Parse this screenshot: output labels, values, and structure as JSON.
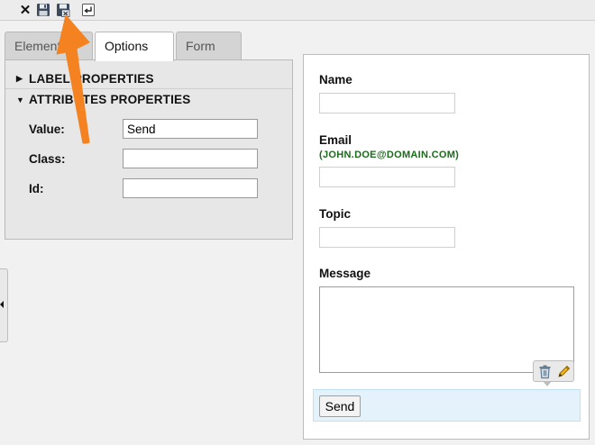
{
  "toolbar": {
    "close_glyph": "✕",
    "icons": [
      "close-icon",
      "save-icon",
      "save-and-close-icon",
      "return-icon"
    ]
  },
  "tabs": [
    {
      "label": "Elements"
    },
    {
      "label": "Options",
      "active": true
    },
    {
      "label": "Form"
    }
  ],
  "options_panel": {
    "sections": [
      {
        "label": "LABEL PROPERTIES",
        "expanded": false,
        "glyph": "▶"
      },
      {
        "label": "ATTRIBUTES PROPERTIES",
        "expanded": true,
        "glyph": "▼"
      }
    ],
    "fields": [
      {
        "label": "Value:",
        "value": "Send"
      },
      {
        "label": "Class:",
        "value": ""
      },
      {
        "label": "Id:",
        "value": ""
      }
    ]
  },
  "form_preview": {
    "fields": [
      {
        "label": "Name"
      },
      {
        "label": "Email",
        "note": "(JOHN.DOE@DOMAIN.COM)"
      },
      {
        "label": "Topic"
      },
      {
        "label": "Message"
      }
    ],
    "submit_label": "Send",
    "element_tools": [
      "trash-icon",
      "pencil-icon"
    ]
  },
  "colors": {
    "annotation_arrow": "#f58220",
    "email_note": "#1a6b1a",
    "selected_row_bg": "#e4f3fb"
  }
}
